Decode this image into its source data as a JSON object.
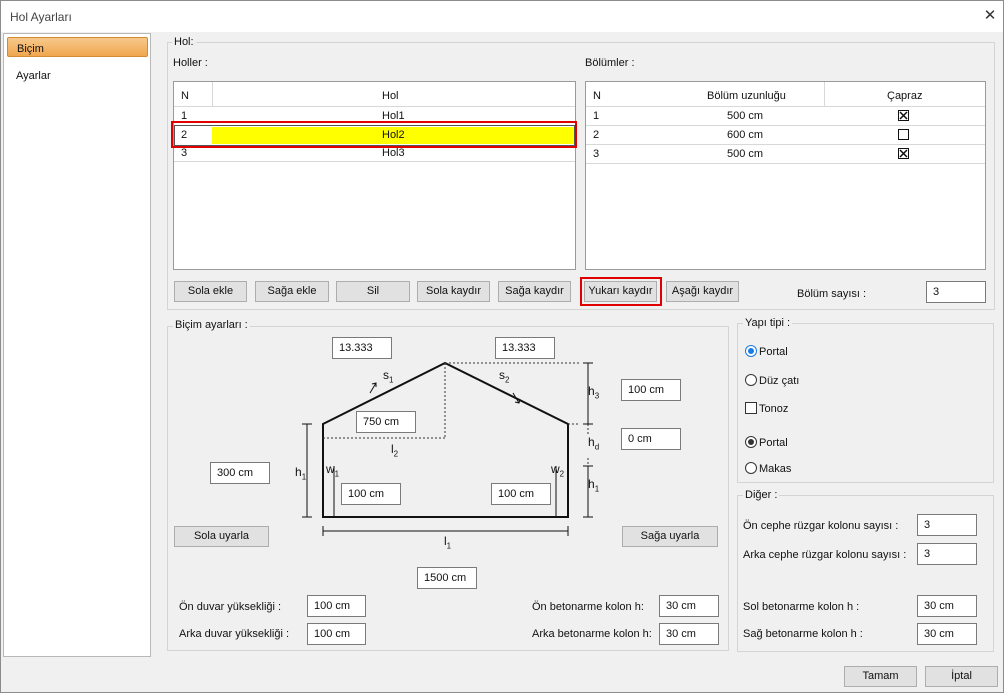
{
  "window": {
    "title": "Hol Ayarları"
  },
  "sidebar": {
    "items": [
      {
        "label": "Biçim"
      },
      {
        "label": "Ayarlar"
      }
    ]
  },
  "hol_group": {
    "label": "Hol:",
    "holler_label": "Holler :",
    "bolumler_label": "Bölümler :",
    "holler_table": {
      "headers": [
        "N",
        "Hol"
      ],
      "rows": [
        {
          "n": "1",
          "name": "Hol1"
        },
        {
          "n": "2",
          "name": "Hol2"
        },
        {
          "n": "3",
          "name": "Hol3"
        }
      ],
      "selected_row": "2",
      "selected_color": "#ffff00"
    },
    "bolumler_table": {
      "headers": [
        "N",
        "Bölüm uzunluğu",
        "Çapraz"
      ],
      "rows": [
        {
          "n": "1",
          "length": "500 cm",
          "capraz": true
        },
        {
          "n": "2",
          "length": "600 cm",
          "capraz": false
        },
        {
          "n": "3",
          "length": "500 cm",
          "capraz": true
        }
      ]
    },
    "buttons": {
      "sola_ekle": "Sola ekle",
      "saga_ekle": "Sağa ekle",
      "sil": "Sil",
      "sola_kaydir": "Sola kaydır",
      "saga_kaydir": "Sağa kaydır",
      "yukari_kaydir": "Yukarı kaydır",
      "asagi_kaydir": "Aşağı kaydır"
    },
    "bolum_sayisi_label": "Bölüm sayısı :",
    "bolum_sayisi_value": "3"
  },
  "bicim": {
    "label": "Biçim ayarları :",
    "s1_value": "13.333",
    "s2_value": "13.333",
    "l2_value": "750 cm",
    "h3_value": "100 cm",
    "hd_value": "0 cm",
    "h1_left_value": "300 cm",
    "w1_value": "100 cm",
    "w2_value": "100 cm",
    "l1_value": "1500 cm",
    "dim_labels": {
      "s": "s",
      "s1_sub": "1",
      "s2_sub": "2",
      "h": "h",
      "h3_sub": "3",
      "hd_sub": "d",
      "h1_sub": "1",
      "l": "l",
      "l1_sub": "1",
      "l2_sub": "2",
      "w": "w",
      "w1_sub": "1",
      "w2_sub": "2"
    },
    "sola_uyarla": "Sola uyarla",
    "saga_uyarla": "Sağa uyarla",
    "on_duvar_label": "Ön duvar yüksekliği :",
    "on_duvar_value": "100 cm",
    "arka_duvar_label": "Arka duvar yüksekliği :",
    "arka_duvar_value": "100 cm",
    "on_kolon_label": "Ön betonarme kolon h:",
    "on_kolon_value": "30 cm",
    "arka_kolon_label": "Arka betonarme kolon h:",
    "arka_kolon_value": "30 cm"
  },
  "yapi_tipi": {
    "label": "Yapı tipi :",
    "portal1": "Portal",
    "duz_cati": "Düz çatı",
    "tonoz": "Tonoz",
    "portal2": "Portal",
    "makas": "Makas"
  },
  "diger": {
    "label": "Diğer :",
    "on_cephe_label": "Ön cephe rüzgar kolonu sayısı :",
    "on_cephe_value": "3",
    "arka_cephe_label": "Arka cephe rüzgar kolonu sayısı :",
    "arka_cephe_value": "3",
    "sol_kolon_label": "Sol betonarme kolon h :",
    "sol_kolon_value": "30 cm",
    "sag_kolon_label": "Sağ betonarme kolon h :",
    "sag_kolon_value": "30 cm"
  },
  "footer": {
    "tamam": "Tamam",
    "iptal": "İptal"
  }
}
